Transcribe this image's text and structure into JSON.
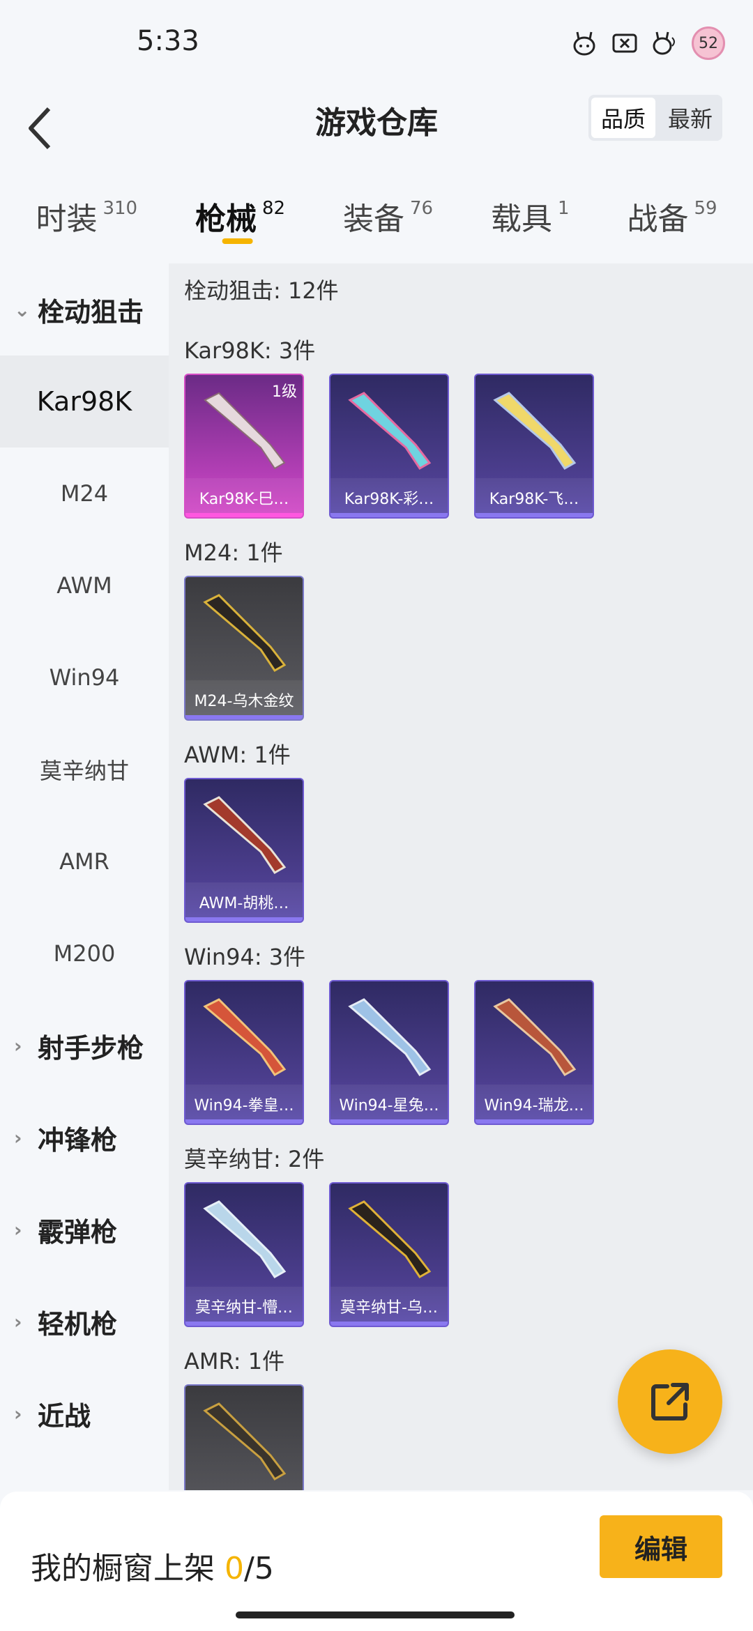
{
  "status": {
    "time": "5:33",
    "badge": "52"
  },
  "nav": {
    "title": "游戏仓库",
    "sort_quality": "品质",
    "sort_newest": "最新"
  },
  "tabs": [
    {
      "label": "时装",
      "count": "310"
    },
    {
      "label": "枪械",
      "count": "82"
    },
    {
      "label": "装备",
      "count": "76"
    },
    {
      "label": "载具",
      "count": "1"
    },
    {
      "label": "战备",
      "count": "59"
    }
  ],
  "sidebar": {
    "categories": [
      "栓动狙击",
      "射手步枪",
      "冲锋枪",
      "霰弹枪",
      "轻机枪",
      "近战"
    ],
    "subitems": [
      "Kar98K",
      "M24",
      "AWM",
      "Win94",
      "莫辛纳甘",
      "AMR",
      "M200"
    ]
  },
  "content": {
    "summary": "栓动狙击: 12件",
    "sections": [
      {
        "title": "Kar98K: 3件",
        "items": [
          {
            "name": "Kar98K-巳…",
            "level": "1级"
          },
          {
            "name": "Kar98K-彩…"
          },
          {
            "name": "Kar98K-飞…"
          }
        ]
      },
      {
        "title": "M24: 1件",
        "items": [
          {
            "name": "M24-乌木金纹"
          }
        ]
      },
      {
        "title": "AWM: 1件",
        "items": [
          {
            "name": "AWM-胡桃…"
          }
        ]
      },
      {
        "title": "Win94: 3件",
        "items": [
          {
            "name": "Win94-拳皇…"
          },
          {
            "name": "Win94-星兔…"
          },
          {
            "name": "Win94-瑞龙…"
          }
        ]
      },
      {
        "title": "莫辛纳甘: 2件",
        "items": [
          {
            "name": "莫辛纳甘-懵…"
          },
          {
            "name": "莫辛纳甘-乌…"
          }
        ]
      },
      {
        "title": "AMR: 1件",
        "items": []
      }
    ]
  },
  "bottom": {
    "shelf_label": "我的橱窗上架 ",
    "shelf_current": "0",
    "shelf_total": "/5",
    "edit_label": "编辑"
  },
  "colors": {
    "accent": "#f5b400",
    "button": "#f7b21a",
    "card_purple": "#4c3e8e",
    "card_pink": "#d54bc8"
  }
}
